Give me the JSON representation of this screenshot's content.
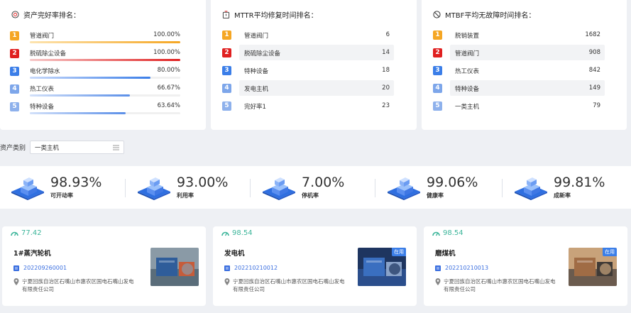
{
  "panels": {
    "health": {
      "title": "资产完好率排名：",
      "rows": [
        {
          "rank": "1",
          "name": "管道阀门",
          "value": "100.00%",
          "pct": 1.0
        },
        {
          "rank": "2",
          "name": "脱硫除尘设备",
          "value": "100.00%",
          "pct": 1.0
        },
        {
          "rank": "3",
          "name": "电化学除水",
          "value": "80.00%",
          "pct": 0.8
        },
        {
          "rank": "4",
          "name": "热工仪表",
          "value": "66.67%",
          "pct": 0.6667
        },
        {
          "rank": "5",
          "name": "特种设备",
          "value": "63.64%",
          "pct": 0.6364
        }
      ]
    },
    "mttr": {
      "title": "MTTR平均修复时间排名：",
      "rows": [
        {
          "rank": "1",
          "name": "管道阀门",
          "value": "6"
        },
        {
          "rank": "2",
          "name": "脱硫除尘设备",
          "value": "14"
        },
        {
          "rank": "3",
          "name": "特种设备",
          "value": "18"
        },
        {
          "rank": "4",
          "name": "发电主机",
          "value": "20"
        },
        {
          "rank": "5",
          "name": "完好率1",
          "value": "23"
        }
      ]
    },
    "mtbf": {
      "title": "MTBF平均无故障时间排名：",
      "rows": [
        {
          "rank": "1",
          "name": "脱销装置",
          "value": "1682"
        },
        {
          "rank": "2",
          "name": "管道阀门",
          "value": "908"
        },
        {
          "rank": "3",
          "name": "热工仪表",
          "value": "842"
        },
        {
          "rank": "4",
          "name": "特种设备",
          "value": "149"
        },
        {
          "rank": "5",
          "name": "一类主机",
          "value": "79"
        }
      ]
    }
  },
  "rank_colors": [
    "#f5a623",
    "#e02020",
    "#3b7ee8",
    "#7da6ea",
    "#8eb1ec"
  ],
  "filter": {
    "label": "资产类别",
    "value": "一类主机"
  },
  "kpis": [
    {
      "value": "98.93%",
      "label": "可开动率"
    },
    {
      "value": "93.00%",
      "label": "利用率"
    },
    {
      "value": "7.00%",
      "label": "停机率"
    },
    {
      "value": "99.06%",
      "label": "健康率"
    },
    {
      "value": "99.81%",
      "label": "成新率"
    }
  ],
  "cards": [
    {
      "score": "77.42",
      "name": "1#蒸汽轮机",
      "code": "202209260001",
      "address": "宁夏回族自治区石嘴山市惠农区国电石嘴山发电有限责任公司",
      "status": ""
    },
    {
      "score": "98.54",
      "name": "发电机",
      "code": "202210210012",
      "address": "宁夏回族自治区石嘴山市惠农区国电石嘴山发电有限责任公司",
      "status": "在用"
    },
    {
      "score": "98.54",
      "name": "磨煤机",
      "code": "202210210013",
      "address": "宁夏回族自治区石嘴山市惠农区国电石嘴山发电有限责任公司",
      "status": "在用"
    }
  ]
}
